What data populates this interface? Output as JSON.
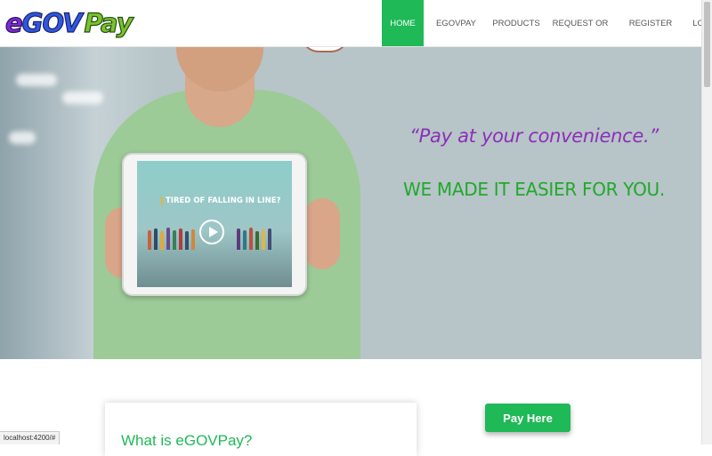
{
  "logo": {
    "part_e": "e",
    "part_gov": "GOV",
    "part_pay": "Pay"
  },
  "nav": {
    "home": "HOME",
    "egovpay": "eGOVPAY",
    "products": "PRODUCTS",
    "request": "REQUEST OR",
    "register": "REGISTER",
    "login": "LOGIN",
    "active_color": "#1fb957"
  },
  "hero": {
    "quote": "“Pay at your convenience.”",
    "tagline": "WE MADE IT EASIER FOR YOU.",
    "tablet_headline": "TIRED OF FALLING IN LINE?",
    "quote_color": "#8b2fb8",
    "tagline_color": "#1faa2a"
  },
  "about": {
    "title": "What is eGOVPay?"
  },
  "pay_button": {
    "label": "Pay Here"
  },
  "status_bar": {
    "url": "localhost:4200/#"
  },
  "icons": {
    "play": "play-icon"
  }
}
